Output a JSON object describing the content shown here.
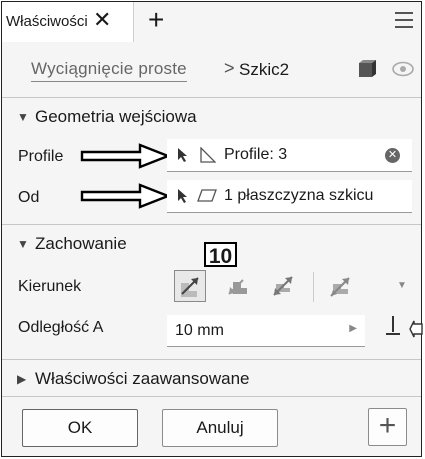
{
  "tab": {
    "label": "Właściwości",
    "close_glyph": "✕",
    "add_glyph": "+"
  },
  "breadcrumb": {
    "link": "Wyciągnięcie proste",
    "separator": ">",
    "current": "Szkic2"
  },
  "input_geometry": {
    "title": "Geometria wejściowa",
    "profile_label": "Profile",
    "profile_value": "Profile: 3",
    "from_label": "Od",
    "from_value": "1 płaszczyzna szkicu"
  },
  "behavior": {
    "title": "Zachowanie",
    "callout": "10",
    "direction_label": "Kierunek",
    "distance_label": "Odległość A",
    "distance_value": "10 mm"
  },
  "advanced": {
    "title": "Właściwości zaawansowane"
  },
  "footer": {
    "ok": "OK",
    "cancel": "Anuluj",
    "add_glyph": "+"
  },
  "icons": [
    "close-icon",
    "add-tab-icon",
    "menu-icon",
    "cube-icon",
    "eye-icon",
    "select-cursor-icon",
    "profile-icon",
    "plane-icon",
    "clear-icon",
    "direction-default-icon",
    "direction-flipped-icon",
    "direction-symmetric-icon",
    "direction-asymmetric-icon",
    "measure-icon",
    "flip-icon"
  ],
  "colors": {
    "background": "#f5f5f5",
    "field": "#ffffff",
    "text": "#1a1a1a"
  }
}
